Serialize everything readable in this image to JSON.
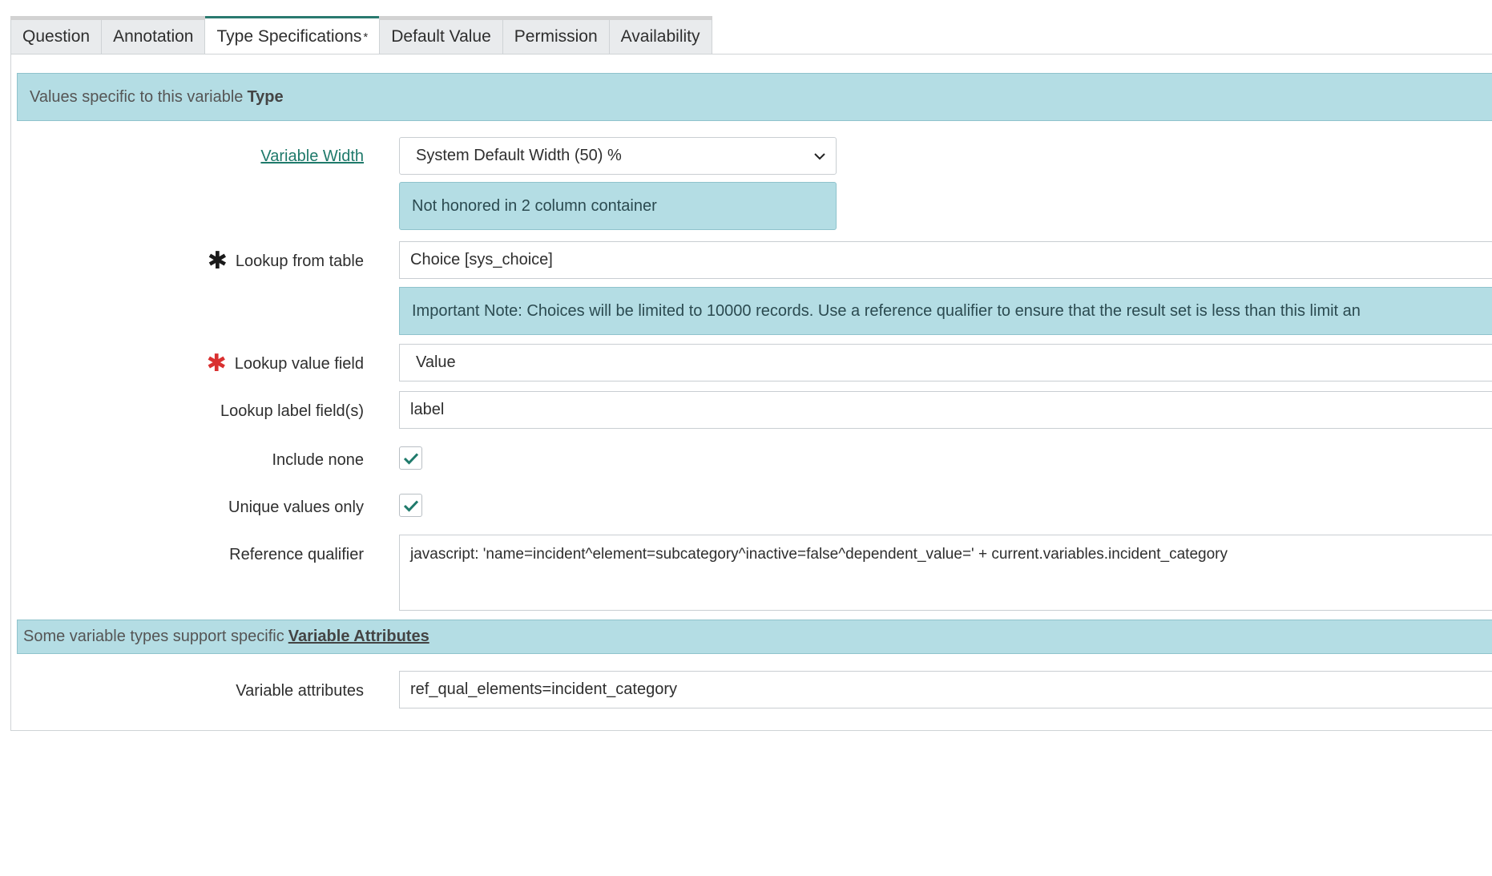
{
  "tabs": [
    {
      "label": "Question",
      "active": false
    },
    {
      "label": "Annotation",
      "active": false
    },
    {
      "label": "Type Specifications",
      "active": true,
      "modified_marker": "*"
    },
    {
      "label": "Default Value",
      "active": false
    },
    {
      "label": "Permission",
      "active": false
    },
    {
      "label": "Availability",
      "active": false
    }
  ],
  "type_section": {
    "prefix": "Values specific to this variable ",
    "bold": "Type"
  },
  "variable_width": {
    "label": "Variable Width",
    "selected": "System Default Width (50) %",
    "note": "Not honored in 2 column container"
  },
  "lookup_table": {
    "label": "Lookup from table",
    "value": "Choice [sys_choice]",
    "note": "Important Note: Choices will be limited to 10000 records. Use a reference qualifier to ensure that the result set is less than this limit an"
  },
  "lookup_value": {
    "label": "Lookup value field",
    "value": "Value"
  },
  "lookup_label": {
    "label": "Lookup label field(s)",
    "value": "label"
  },
  "include_none": {
    "label": "Include none",
    "checked": true
  },
  "unique_values": {
    "label": "Unique values only",
    "checked": true
  },
  "reference_qualifier": {
    "label": "Reference qualifier",
    "value": "javascript: 'name=incident^element=subcategory^inactive=false^dependent_value=' + current.variables.incident_category"
  },
  "attributes_section": {
    "prefix": "Some variable types support specific ",
    "link": "Variable Attributes"
  },
  "variable_attributes": {
    "label": "Variable attributes",
    "value": "ref_qual_elements=incident_category"
  },
  "icons": {
    "required": "asterisk-icon",
    "dropdown": "chevron-down-icon",
    "check": "checkmark-icon"
  },
  "colors": {
    "accent": "#1f7a6b",
    "info_bg": "#b4dde4",
    "required_red": "#d93030"
  }
}
